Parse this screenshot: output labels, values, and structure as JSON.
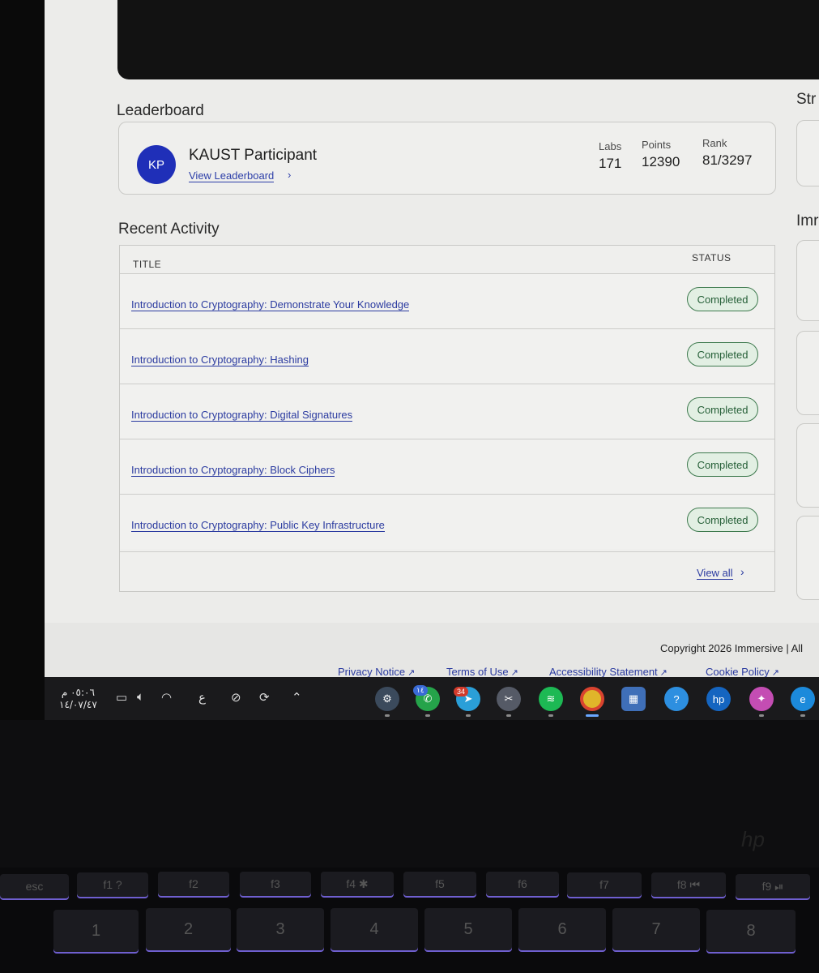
{
  "leaderboard": {
    "title": "Leaderboard",
    "initials": "KP",
    "name": "KAUST Participant",
    "link": "View Leaderboard",
    "stats": [
      {
        "label": "Labs",
        "value": "171"
      },
      {
        "label": "Points",
        "value": "12390"
      },
      {
        "label": "Rank",
        "value": "81/3297"
      }
    ]
  },
  "activity": {
    "title": "Recent Activity",
    "col_title": "TITLE",
    "col_status": "STATUS",
    "rows": [
      {
        "title": "Introduction to Cryptography: Demonstrate Your Knowledge",
        "status": "Completed"
      },
      {
        "title": "Introduction to Cryptography: Hashing",
        "status": "Completed"
      },
      {
        "title": "Introduction to Cryptography: Digital Signatures",
        "status": "Completed"
      },
      {
        "title": "Introduction to Cryptography: Block Ciphers",
        "status": "Completed"
      },
      {
        "title": "Introduction to Cryptography: Public Key Infrastructure",
        "status": "Completed"
      }
    ],
    "view_all": "View all"
  },
  "right_column": {
    "title_1": "Str",
    "title_2": "Imr"
  },
  "footer": {
    "copyright": "Copyright 2026 Immersive | All",
    "links": [
      "Privacy Notice",
      "Terms of Use",
      "Accessibility Statement",
      "Cookie Policy"
    ]
  },
  "taskbar": {
    "time": "٠٥:٠٦ م",
    "date": "١٤/٠٧/٤٧",
    "language": "ع",
    "whatsapp_badge": "١٤",
    "telegram_badge": "34",
    "apps": [
      "settings",
      "whatsapp",
      "telegram",
      "snipping-tool",
      "spotify",
      "chrome",
      "microsoft-store",
      "help",
      "hp",
      "copilot",
      "edge"
    ]
  },
  "keyboard": {
    "fn_row": [
      "esc",
      "f1 ?",
      "f2",
      "f3",
      "f4 ✱",
      "f5",
      "f6",
      "f7",
      "f8 ⏮",
      "f9 ⏯"
    ],
    "num_row": [
      "1",
      "2",
      "3",
      "4",
      "5",
      "6",
      "7",
      "8"
    ],
    "brand": "hp"
  },
  "colors": {
    "link": "#2b3ba0",
    "avatar": "#1f2fb8",
    "badge_border": "#3e7a4e",
    "badge_bg": "#e2efe3"
  }
}
